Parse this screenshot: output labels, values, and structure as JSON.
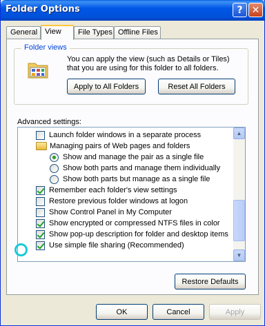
{
  "window": {
    "title": "Folder Options"
  },
  "title_buttons": {
    "help": "?",
    "close": "✕"
  },
  "tabs": [
    {
      "label": "General"
    },
    {
      "label": "View"
    },
    {
      "label": "File Types"
    },
    {
      "label": "Offline Files"
    }
  ],
  "folder_views": {
    "title": "Folder views",
    "description": "You can apply the view (such as Details or Tiles) that you are using for this folder to all folders.",
    "apply_button": "Apply to All Folders",
    "reset_button": "Reset All Folders"
  },
  "advanced": {
    "label": "Advanced settings:",
    "items": [
      {
        "type": "checkbox",
        "checked": false,
        "label": "Launch folder windows in a separate process"
      },
      {
        "type": "folder",
        "label": "Managing pairs of Web pages and folders"
      },
      {
        "type": "radio",
        "checked": true,
        "label": "Show and manage the pair as a single file"
      },
      {
        "type": "radio",
        "checked": false,
        "label": "Show both parts and manage them individually"
      },
      {
        "type": "radio",
        "checked": false,
        "label": "Show both parts but manage as a single file"
      },
      {
        "type": "checkbox",
        "checked": true,
        "label": "Remember each folder's view settings"
      },
      {
        "type": "checkbox",
        "checked": false,
        "label": "Restore previous folder windows at logon"
      },
      {
        "type": "checkbox",
        "checked": false,
        "label": "Show Control Panel in My Computer"
      },
      {
        "type": "checkbox",
        "checked": true,
        "label": "Show encrypted or compressed NTFS files in color"
      },
      {
        "type": "checkbox",
        "checked": true,
        "label": "Show pop-up description for folder and desktop items"
      },
      {
        "type": "checkbox",
        "checked": true,
        "label": "Use simple file sharing (Recommended)"
      }
    ]
  },
  "buttons": {
    "restore_defaults": "Restore Defaults",
    "ok": "OK",
    "cancel": "Cancel",
    "apply": "Apply"
  },
  "colors": {
    "titlebar": "#0054E3",
    "group_label": "#0046D5",
    "highlight": "#19C9D8"
  }
}
